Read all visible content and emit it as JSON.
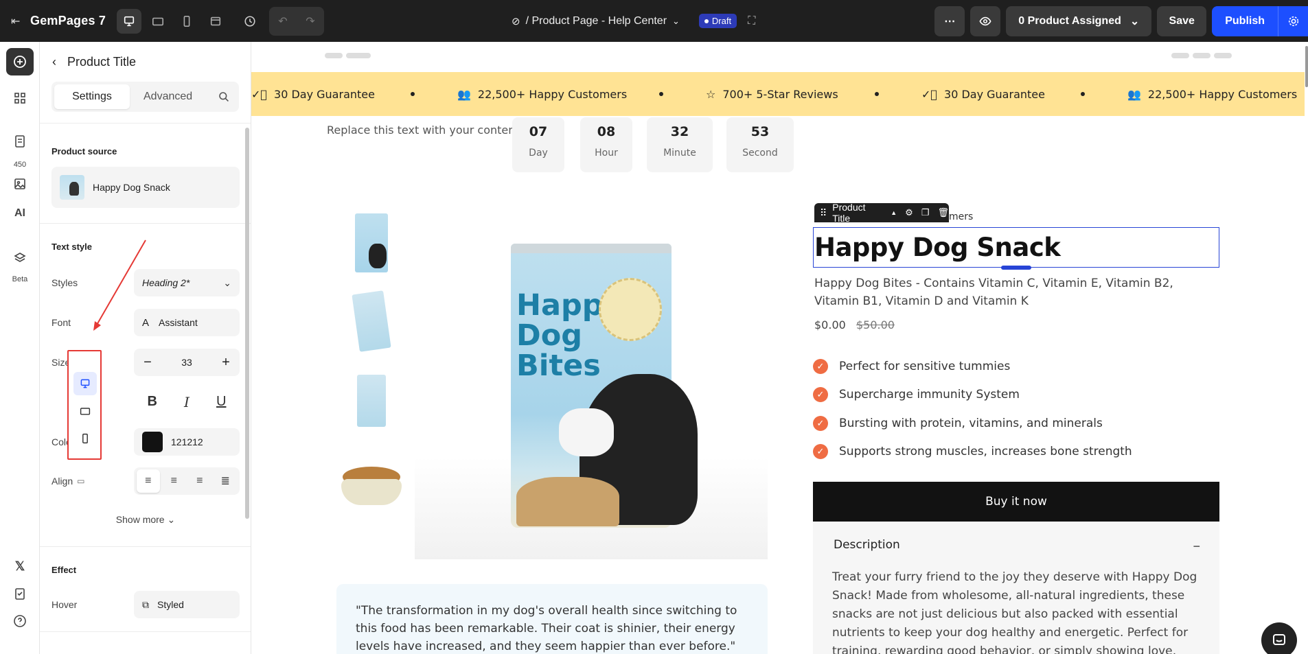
{
  "topbar": {
    "brand": "GemPages 7",
    "page_name": "/ Product Page - Help Center",
    "status": "Draft",
    "product_assigned": "0 Product Assigned",
    "save": "Save",
    "publish": "Publish"
  },
  "rail": {
    "count": "450",
    "beta": "Beta"
  },
  "panel": {
    "header": "Product Title",
    "tabs": [
      "Settings",
      "Advanced"
    ],
    "product_source_label": "Product source",
    "product_source_value": "Happy Dog Snack",
    "text_style_label": "Text style",
    "styles_label": "Styles",
    "styles_value": "Heading 2*",
    "font_label": "Font",
    "font_value": "Assistant",
    "size_label": "Size",
    "size_value": "33",
    "color_label": "Color",
    "color_value": "121212",
    "align_label": "Align",
    "show_more": "Show more",
    "effect_label": "Effect",
    "hover_label": "Hover",
    "hover_value": "Styled"
  },
  "canvas": {
    "ticker": [
      "30 Day Guarantee",
      "22,500+ Happy Customers",
      "700+ 5-Star Reviews",
      "30 Day Guarantee",
      "22,500+ Happy Customers"
    ],
    "replace_text": "Replace this text with your content",
    "countdown": [
      {
        "num": "07",
        "label": "Day"
      },
      {
        "num": "08",
        "label": "Hour"
      },
      {
        "num": "32",
        "label": "Minute"
      },
      {
        "num": "53",
        "label": "Second"
      }
    ],
    "bag_title": "Happy Dog Bites",
    "selection_label": "Product Title",
    "behind_text": "mers",
    "product_title": "Happy Dog Snack",
    "subtitle": "Happy Dog Bites - Contains Vitamin C, Vitamin E, Vitamin B2, Vitamin B1, Vitamin D and Vitamin K",
    "price": "$0.00",
    "compare_price": "$50.00",
    "features": [
      "Perfect for sensitive tummies",
      "Supercharge immunity System",
      "Bursting with protein, vitamins, and minerals",
      "Supports strong muscles, increases bone strength"
    ],
    "buy_now": "Buy it now",
    "description_title": "Description",
    "description_body": "Treat your furry friend to the joy they deserve with Happy Dog Snack! Made from wholesome, all-natural ingredients, these snacks are not just delicious but also packed with essential nutrients to keep your dog healthy and energetic. Perfect for training, rewarding good behavior, or simply showing love, each bite delivers tail-",
    "quote": "\"The transformation in my dog's overall health since switching to this food has been remarkable. Their coat is shinier, their energy levels have increased, and they seem happier than ever before.\""
  },
  "colors": {
    "accent": "#1d4fff",
    "ticker_bg": "#ffe394",
    "check": "#ef6c43",
    "highlight": "#e53935"
  }
}
